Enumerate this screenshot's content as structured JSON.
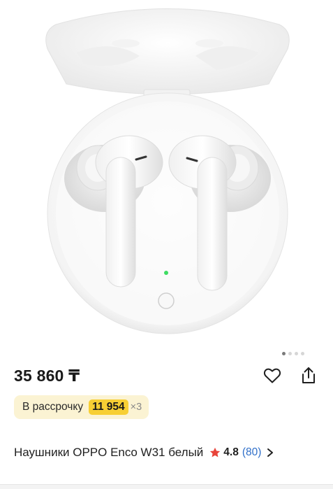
{
  "product": {
    "price": "35 860 ₸",
    "installment_label": "В рассрочку",
    "installment_amount": "11 954",
    "installment_multiplier": "×3",
    "title": "Наушники OPPO Enco W31 белый",
    "rating": "4.8",
    "reviews": "(80)"
  },
  "gallery": {
    "image_count": 4,
    "active_index": 0
  },
  "icons": {
    "favorite": "heart-icon",
    "share": "share-icon",
    "rating": "star-icon",
    "more": "chevron-right-icon"
  },
  "colors": {
    "installment_bg": "#fbf3d3",
    "installment_amount_bg": "#f7cf34",
    "star": "#e8443a",
    "reviews_link": "#2f6fc9"
  }
}
